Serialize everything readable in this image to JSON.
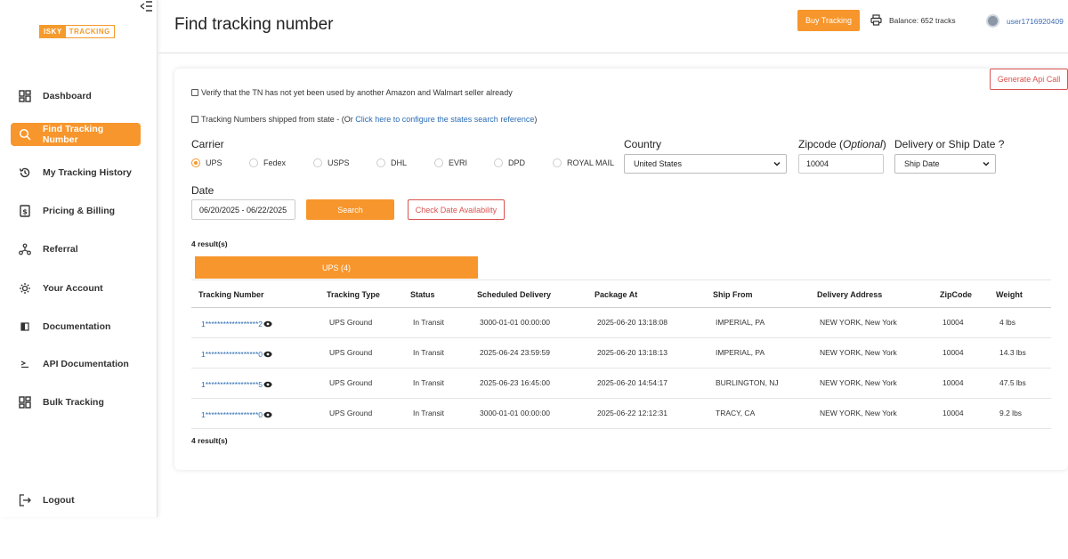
{
  "sidebar": {
    "logo_part1": "ISKY",
    "logo_part2": "TRACKING",
    "items": [
      {
        "label": "Dashboard"
      },
      {
        "label": "Find Tracking Number"
      },
      {
        "label": "My Tracking History"
      },
      {
        "label": "Pricing & Billing"
      },
      {
        "label": "Referral"
      },
      {
        "label": "Your Account"
      },
      {
        "label": "Documentation"
      },
      {
        "label": "API Documentation"
      },
      {
        "label": "Bulk Tracking"
      }
    ],
    "logout": "Logout"
  },
  "header": {
    "title": "Find tracking number",
    "buy_label": "Buy Tracking",
    "balance": "Balance: 652 tracks",
    "username": "user1716920409"
  },
  "form": {
    "generate_label": "Generate Api Call",
    "check1": "Verify that the TN has not yet been used by another Amazon and Walmart seller already",
    "check2_prefix": "Tracking Numbers shipped from state - (Or ",
    "check2_link": "Click here to configure the states search reference",
    "check2_suffix": ")",
    "carrier_label": "Carrier",
    "carriers": [
      "UPS",
      "Fedex",
      "USPS",
      "DHL",
      "EVRI",
      "DPD",
      "ROYAL MAIL"
    ],
    "selected_carrier": "UPS",
    "country_label": "Country",
    "country_value": "United States",
    "zipcode_label": "Zipcode (",
    "zipcode_optional": "Optional",
    "zipcode_close": ")",
    "zipcode_value": "10004",
    "date_type_label": "Delivery or Ship Date ?",
    "date_type_value": "Ship Date",
    "date_label": "Date",
    "date_value": "06/20/2025 - 06/22/2025",
    "search_label": "Search",
    "check_date_label": "Check Date Availability"
  },
  "results": {
    "count_top": "4 result(s)",
    "count_bottom": "4 result(s)",
    "tab": "UPS (4)",
    "headers": [
      "Tracking Number",
      "Tracking Type",
      "Status",
      "Scheduled Delivery",
      "Package At",
      "Ship From",
      "Delivery Address",
      "ZipCode",
      "Weight"
    ],
    "rows": [
      [
        "1******************2",
        "UPS Ground",
        "In Transit",
        "3000-01-01 00:00:00",
        "2025-06-20 13:18:08",
        "IMPERIAL, PA",
        "NEW YORK, New York",
        "10004",
        "4 lbs"
      ],
      [
        "1******************0",
        "UPS Ground",
        "In Transit",
        "2025-06-24 23:59:59",
        "2025-06-20 13:18:13",
        "IMPERIAL, PA",
        "NEW YORK, New York",
        "10004",
        "14.3 lbs"
      ],
      [
        "1******************5",
        "UPS Ground",
        "In Transit",
        "2025-06-23 16:45:00",
        "2025-06-20 14:54:17",
        "BURLINGTON, NJ",
        "NEW YORK, New York",
        "10004",
        "47.5 lbs"
      ],
      [
        "1******************0",
        "UPS Ground",
        "In Transit",
        "3000-01-01 00:00:00",
        "2025-06-22 12:12:31",
        "TRACY, CA",
        "NEW YORK, New York",
        "10004",
        "9.2 lbs"
      ]
    ]
  },
  "colors": {
    "accent": "#f7962c",
    "link": "#2c6db3",
    "danger": "#d9534f"
  },
  "icons": [
    "collapse-menu-icon",
    "dashboard-icon",
    "search-icon",
    "history-icon",
    "billing-icon",
    "referral-icon",
    "account-icon",
    "documentation-icon",
    "api-icon",
    "bulk-icon",
    "logout-icon",
    "printer-icon",
    "eye-icon",
    "chevron-down-icon"
  ]
}
